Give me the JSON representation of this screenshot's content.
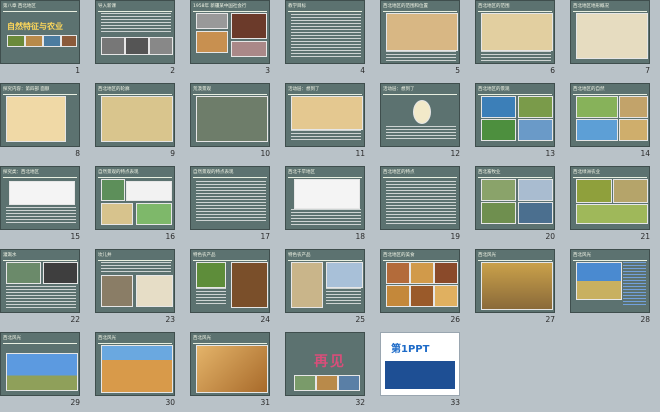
{
  "slides": [
    {
      "n": "1",
      "title": "第八章 西北地区",
      "big": "自然特征与农业"
    },
    {
      "n": "2",
      "title": "导入新课"
    },
    {
      "n": "3",
      "title": "1958年 新疆某中国社会行"
    },
    {
      "n": "4",
      "title": "教学目标"
    },
    {
      "n": "5",
      "title": "西北地区的范围和位置"
    },
    {
      "n": "6",
      "title": "西北地区的范围"
    },
    {
      "n": "7",
      "title": "西北地区地形概况"
    },
    {
      "n": "8",
      "title": "探究内容：第四部 面额"
    },
    {
      "n": "9",
      "title": "西北地区的轮廓"
    },
    {
      "n": "10",
      "title": "荒漠景观"
    },
    {
      "n": "11",
      "title": "活动层：想到了"
    },
    {
      "n": "12",
      "title": "活动层：想到了"
    },
    {
      "n": "13",
      "title": "西北地区的景观"
    },
    {
      "n": "14",
      "title": "西北地区的自然"
    },
    {
      "n": "15",
      "title": "探究类：西北地区"
    },
    {
      "n": "16",
      "title": "自然景观的特点表现"
    },
    {
      "n": "17",
      "title": "自然景观的特点表现"
    },
    {
      "n": "18",
      "title": "西北干旱地区"
    },
    {
      "n": "19",
      "title": "西北地区的特点"
    },
    {
      "n": "20",
      "title": "西北畜牧业"
    },
    {
      "n": "21",
      "title": "西北绿洲农业"
    },
    {
      "n": "22",
      "title": "灌溉水"
    },
    {
      "n": "23",
      "title": "坎儿井"
    },
    {
      "n": "24",
      "title": "特色农产品"
    },
    {
      "n": "25",
      "title": "特色农产品"
    },
    {
      "n": "26",
      "title": "西北地区的美食"
    },
    {
      "n": "27",
      "title": "西北风光"
    },
    {
      "n": "28",
      "title": "西北风光"
    },
    {
      "n": "29",
      "title": "西北风光"
    },
    {
      "n": "30",
      "title": "西北风光"
    },
    {
      "n": "31",
      "title": "西北风光"
    },
    {
      "n": "32",
      "title": "",
      "big": "再见"
    },
    {
      "n": "33",
      "title": "",
      "logo": "第1PPT"
    }
  ]
}
